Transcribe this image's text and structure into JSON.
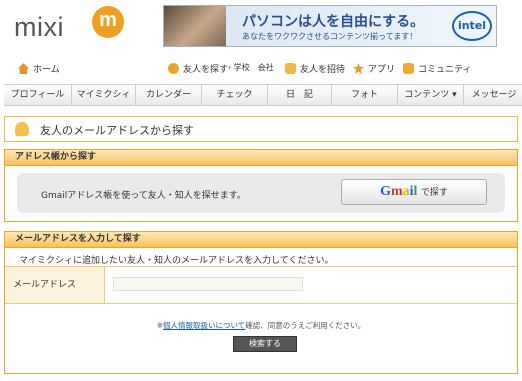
{
  "header": {
    "logo_text": "mixi",
    "logo_badge": "m",
    "banner": {
      "headline": "パソコンは人を自由にする。",
      "subline": "あなたをワクワクさせるコンテンツ揃ってます！",
      "brand": "intel"
    }
  },
  "subnav": {
    "home": "ホーム",
    "find_friends": "友人を探す",
    "find_links": "› 学校　会社",
    "invite": "友人を招待",
    "apps": "アプリ",
    "community": "コミュニティ"
  },
  "tabs": [
    "プロフィール",
    "マイミクシィ",
    "カレンダー",
    "チェック",
    "日　記",
    "フォト",
    "コンテンツ ▾",
    "メッセージ"
  ],
  "page_title": "友人のメールアドレスから探す",
  "address_book": {
    "heading": "アドレス帳から探す",
    "description": "Gmailアドレス帳を使って友人・知人を探せます。",
    "gmail_logo": "Gmail",
    "gmail_button": "で探す"
  },
  "email_section": {
    "heading": "メールアドレスを入力して探す",
    "description": "マイミクシィに追加したい友人・知人のメールアドレスを入力してください。",
    "field_label": "メールアドレス",
    "field_value": "",
    "notice_prefix": "※",
    "notice_link": "個人情報取扱いについて",
    "notice_suffix": "確認、同意のうえご利用ください。",
    "submit_label": "検索する"
  },
  "colors": {
    "accent_orange": "#f7c15a",
    "border_orange": "#e8a530",
    "logo_orange": "#f0a020"
  }
}
